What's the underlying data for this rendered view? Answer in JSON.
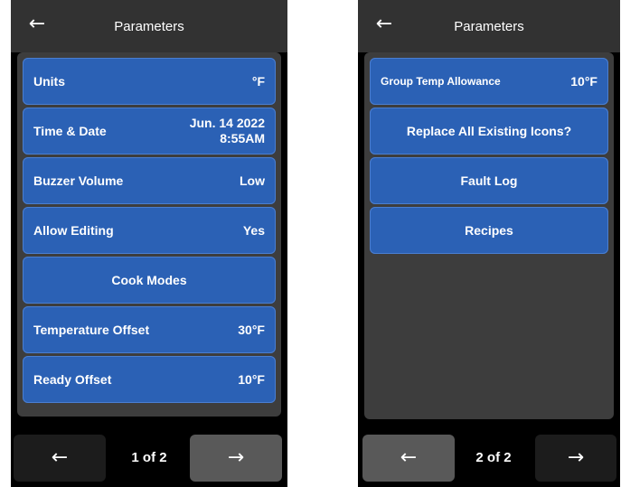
{
  "screen1": {
    "header": {
      "back_icon": "←",
      "title": "Parameters"
    },
    "rows": [
      {
        "label": "Units",
        "value": "°F"
      },
      {
        "label": "Time & Date",
        "value": "Jun. 14 2022\n8:55AM"
      },
      {
        "label": "Buzzer Volume",
        "value": "Low"
      },
      {
        "label": "Allow Editing",
        "value": "Yes"
      },
      {
        "label": "Cook Modes",
        "value": ""
      },
      {
        "label": "Temperature Offset",
        "value": "30°F"
      },
      {
        "label": "Ready Offset",
        "value": "10°F"
      }
    ],
    "footer": {
      "prev_icon": "←",
      "page": "1 of 2",
      "next_icon": "→"
    }
  },
  "screen2": {
    "header": {
      "back_icon": "←",
      "title": "Parameters"
    },
    "rows": [
      {
        "label": "Group Temp Allowance",
        "value": "10°F"
      },
      {
        "label": "Replace All Existing Icons?",
        "value": ""
      },
      {
        "label": "Fault Log",
        "value": ""
      },
      {
        "label": "Recipes",
        "value": ""
      }
    ],
    "footer": {
      "prev_icon": "←",
      "page": "2 of 2",
      "next_icon": "→"
    }
  },
  "colors": {
    "button_blue": "#2b61b5",
    "header_gray": "#323232",
    "panel_gray": "#3d3d3d",
    "nav_dark": "#1c1c1c",
    "nav_light": "#595959"
  }
}
